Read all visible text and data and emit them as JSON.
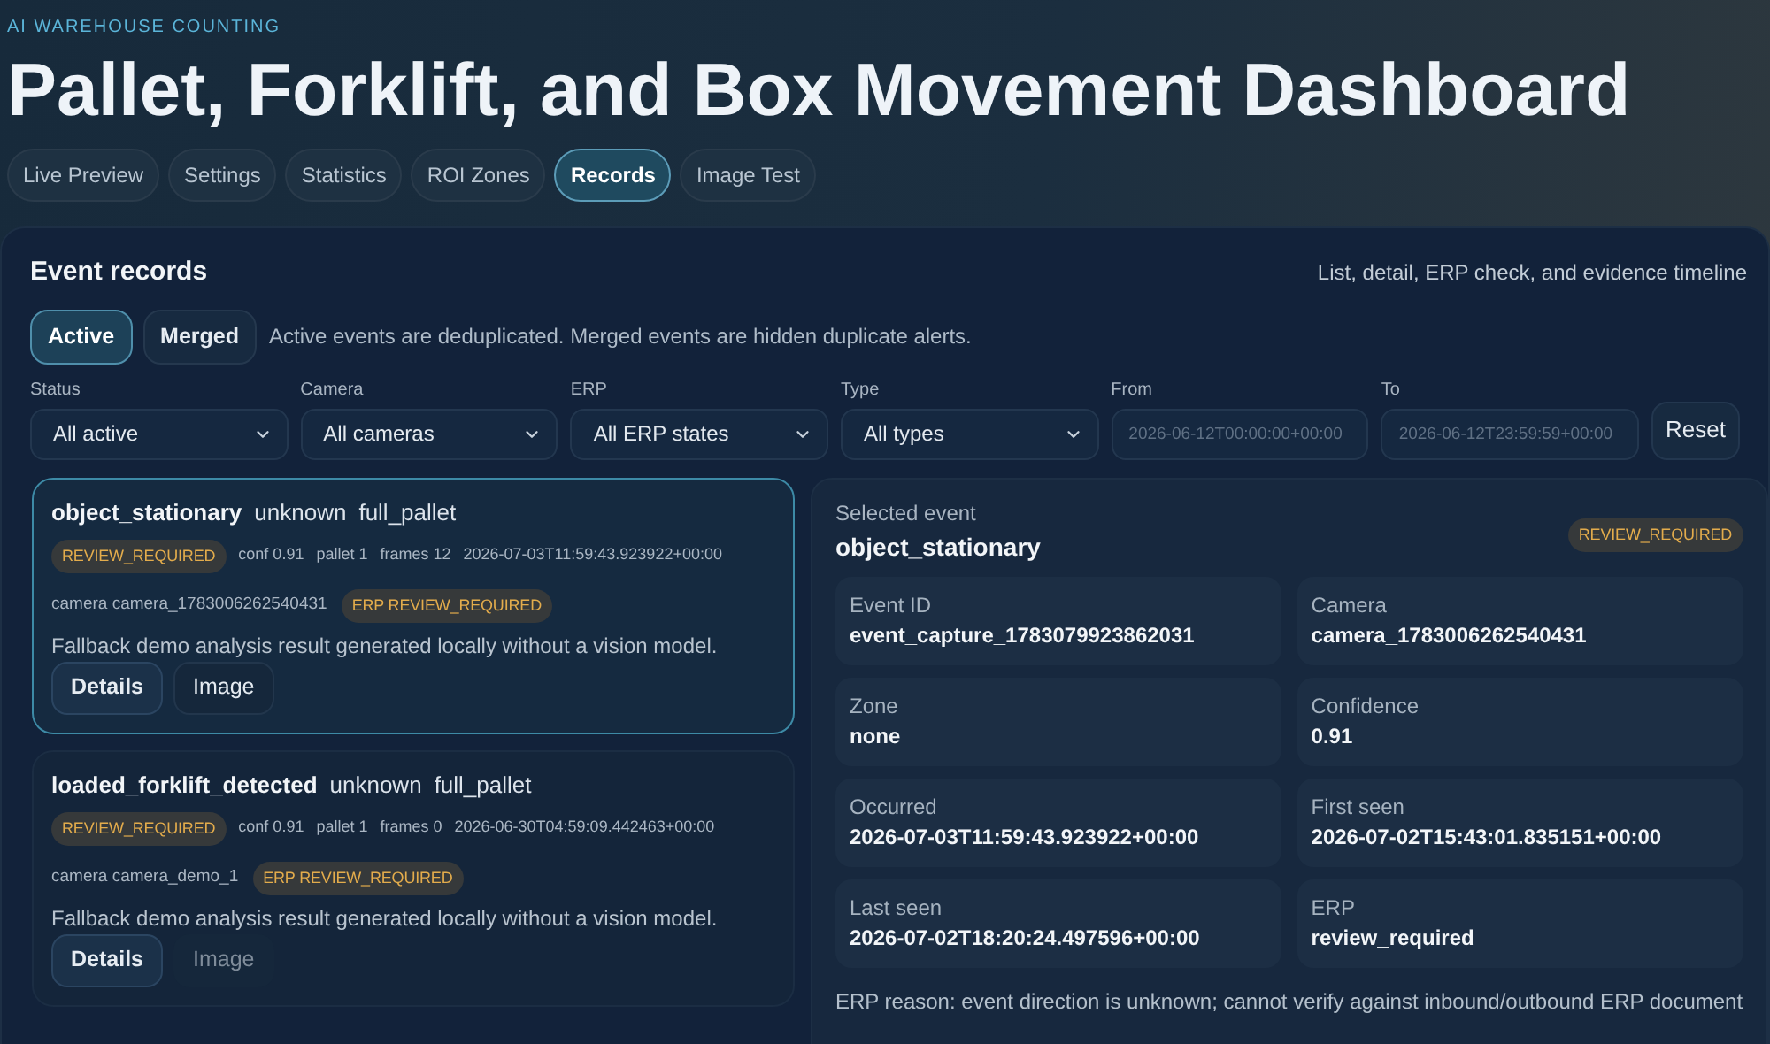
{
  "header": {
    "eyebrow": "AI WAREHOUSE COUNTING",
    "title": "Pallet, Forklift, and Box Movement Dashboard"
  },
  "tabs": [
    {
      "label": "Live Preview",
      "selected": false
    },
    {
      "label": "Settings",
      "selected": false
    },
    {
      "label": "Statistics",
      "selected": false
    },
    {
      "label": "ROI Zones",
      "selected": false
    },
    {
      "label": "Records",
      "selected": true
    },
    {
      "label": "Image Test",
      "selected": false
    }
  ],
  "panel": {
    "title": "Event records",
    "subtitle": "List, detail, ERP check, and evidence timeline"
  },
  "view_toggle": [
    {
      "label": "Active",
      "selected": true
    },
    {
      "label": "Merged",
      "selected": false
    }
  ],
  "view_note": "Active events are deduplicated. Merged events are hidden duplicate alerts.",
  "filters": [
    {
      "kind": "select",
      "label": "Status",
      "value": "All active"
    },
    {
      "kind": "select",
      "label": "Camera",
      "value": "All cameras"
    },
    {
      "kind": "select",
      "label": "ERP",
      "value": "All ERP states"
    },
    {
      "kind": "select",
      "label": "Type",
      "value": "All types"
    },
    {
      "kind": "date",
      "label": "From",
      "placeholder": "2026-06-12T00:00:00+00:00"
    },
    {
      "kind": "date",
      "label": "To",
      "placeholder": "2026-06-12T23:59:59+00:00"
    }
  ],
  "reset_button": "Reset",
  "events": [
    {
      "selected": true,
      "type": "object_stationary",
      "direction": "unknown",
      "object_class": "full_pallet",
      "status": "REVIEW_REQUIRED",
      "meta": [
        "conf 0.91",
        "pallet 1",
        "frames 12",
        "2026-07-03T11:59:43.923922+00:00"
      ],
      "camera": "camera camera_1783006262540431",
      "erp_badge": "ERP REVIEW_REQUIRED",
      "summary": "Fallback demo analysis result generated locally without a vision model.",
      "buttons": [
        {
          "label": "Details",
          "kind": "primary",
          "disabled": false
        },
        {
          "label": "Image",
          "kind": "secondary",
          "disabled": false
        }
      ]
    },
    {
      "selected": false,
      "type": "loaded_forklift_detected",
      "direction": "unknown",
      "object_class": "full_pallet",
      "status": "REVIEW_REQUIRED",
      "meta": [
        "conf 0.91",
        "pallet 1",
        "frames 0",
        "2026-06-30T04:59:09.442463+00:00"
      ],
      "camera": "camera camera_demo_1",
      "erp_badge": "ERP REVIEW_REQUIRED",
      "summary": "Fallback demo analysis result generated locally without a vision model.",
      "buttons": [
        {
          "label": "Details",
          "kind": "primary",
          "disabled": false
        },
        {
          "label": "Image",
          "kind": "secondary",
          "disabled": true
        }
      ]
    }
  ],
  "detail": {
    "label": "Selected event",
    "title": "object_stationary",
    "status": "REVIEW_REQUIRED",
    "fields": [
      {
        "label": "Event ID",
        "value": "event_capture_1783079923862031"
      },
      {
        "label": "Camera",
        "value": "camera_1783006262540431"
      },
      {
        "label": "Zone",
        "value": "none"
      },
      {
        "label": "Confidence",
        "value": "0.91"
      },
      {
        "label": "Occurred",
        "value": "2026-07-03T11:59:43.923922+00:00"
      },
      {
        "label": "First seen",
        "value": "2026-07-02T15:43:01.835151+00:00"
      },
      {
        "label": "Last seen",
        "value": "2026-07-02T18:20:24.497596+00:00"
      },
      {
        "label": "ERP",
        "value": "review_required"
      }
    ],
    "erp_reason": "ERP reason: event direction is unknown; cannot verify against inbound/outbound ERP document"
  }
}
